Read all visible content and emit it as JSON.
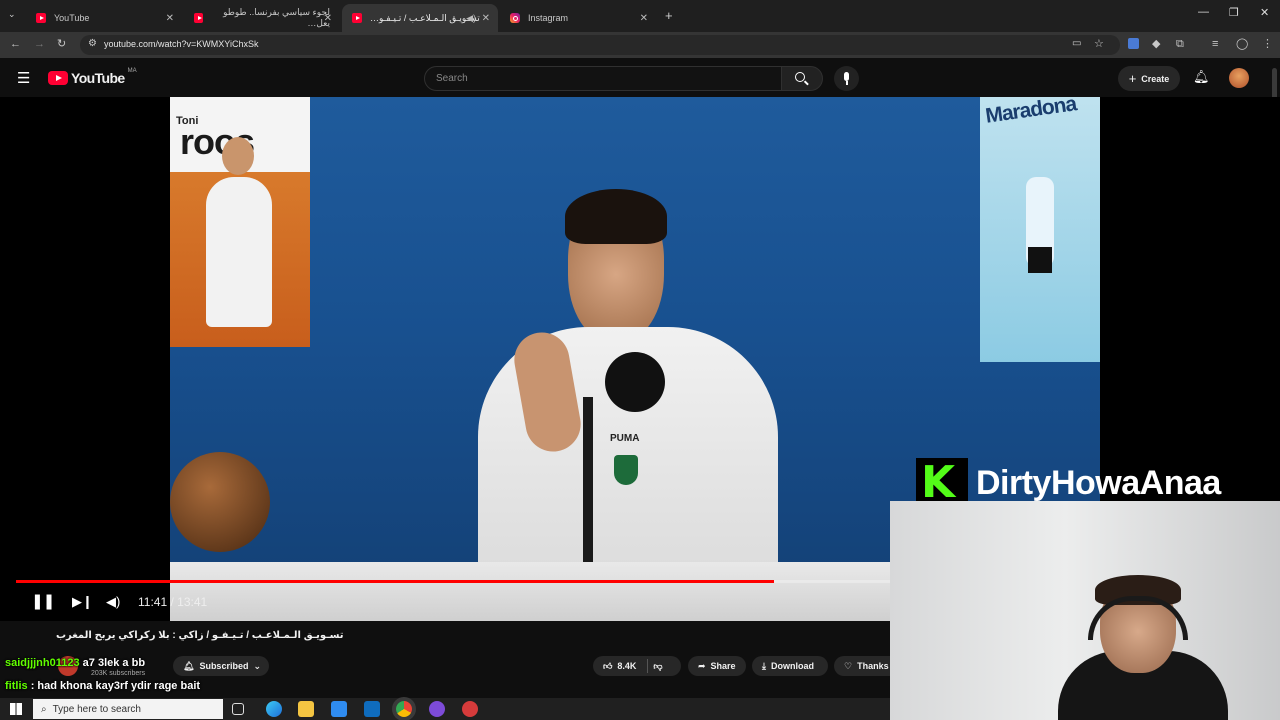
{
  "browser": {
    "tabs": [
      {
        "title": "YouTube",
        "active": false
      },
      {
        "title": "لجوء سياسي بفرنسا.. طوطو يعل…",
        "active": false
      },
      {
        "title": "تسـويـق الـمـلاعـب / تـيـفـو…",
        "active": true
      },
      {
        "title": "Instagram",
        "active": false
      }
    ],
    "url": "youtube.com/watch?v=KWMXYiChxSk"
  },
  "youtube": {
    "logo": "YouTube",
    "region": "MA",
    "search_placeholder": "Search",
    "create_label": "Create"
  },
  "video": {
    "poster_left_name": "Toni",
    "poster_left_big": "roos",
    "poster_right_name": "Maradona",
    "jersey_brand": "PUMA",
    "progress": 0.867,
    "time": "11:41 / 13:41",
    "title": "تسـويـق الـمـلاعـب / تـيـفـو / زاكي : بلا ركراكي يربح المغرب"
  },
  "channel": {
    "subscribers": "203K subscribers",
    "subscribed_label": "Subscribed"
  },
  "actions": {
    "likes": "8.4K",
    "share": "Share",
    "download": "Download",
    "thanks": "Thanks"
  },
  "chat": [
    {
      "user": "saidjjjnh01123",
      "message": "a7 3lek a bb"
    },
    {
      "user": "fitlis",
      "message": "had khona kay3rf ydir rage bait"
    }
  ],
  "stream_overlay": {
    "kick_logo": "K",
    "streamer": "DirtyHowaAnaa"
  },
  "taskbar": {
    "search_placeholder": "Type here to search"
  },
  "colors": {
    "progress": "#ff0000",
    "kick_green": "#53fc18",
    "chat_user": "#62ff00"
  }
}
